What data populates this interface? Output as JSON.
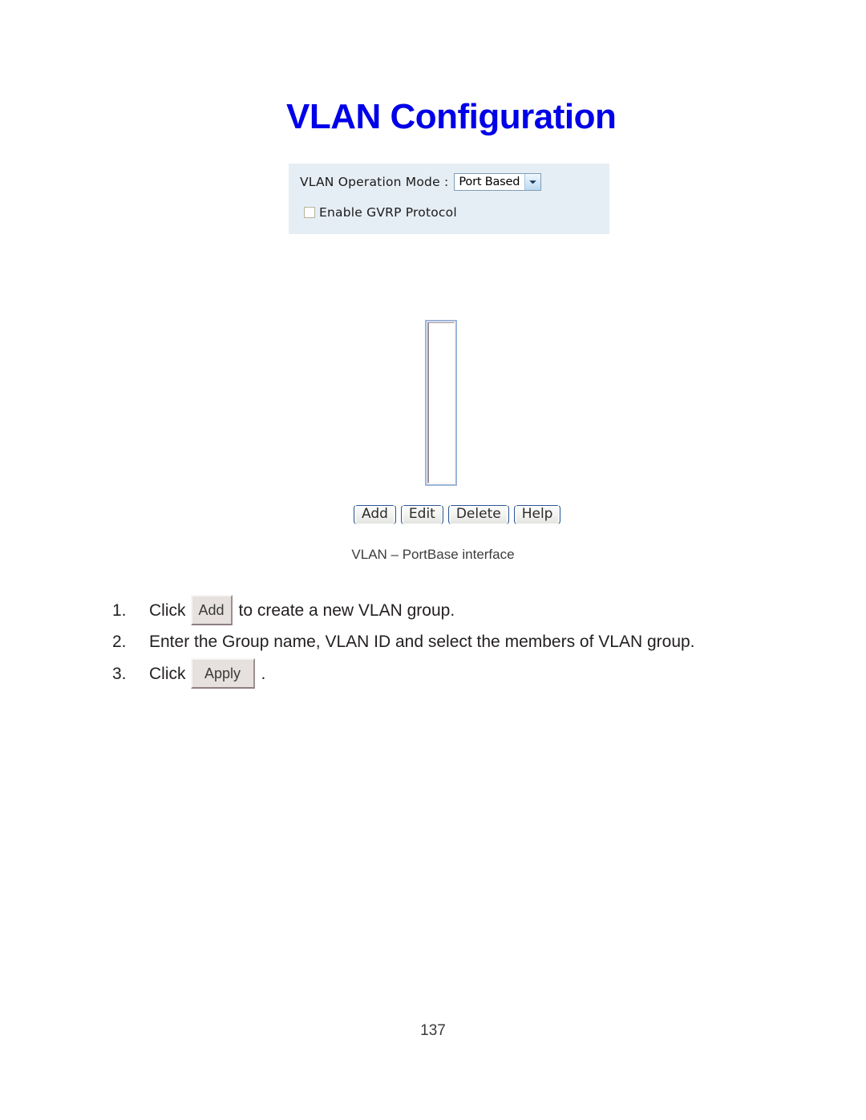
{
  "document": {
    "page_number": "137"
  },
  "page_title": "VLAN Configuration",
  "settings_panel": {
    "operation_mode": {
      "label": "VLAN Operation Mode :",
      "selected_value": "Port Based",
      "arrow_icon": "chevron-down-icon"
    },
    "gvrp": {
      "label": "Enable GVRP Protocol",
      "checked": false
    },
    "background_color": "#e6eef5"
  },
  "vlan_list": {
    "items": [],
    "empty": true
  },
  "buttons": [
    {
      "label": "Add"
    },
    {
      "label": "Edit"
    },
    {
      "label": "Delete"
    },
    {
      "label": "Help"
    }
  ],
  "figure_caption": "VLAN – PortBase interface",
  "steps": [
    {
      "number": "1.",
      "pre_text": "Click",
      "button_label": "Add",
      "post_text": "to create a new VLAN group."
    },
    {
      "number": "2.",
      "pre_text": "Enter the Group name, VLAN ID and select the members of VLAN group.",
      "button_label": "",
      "post_text": ""
    },
    {
      "number": "3.",
      "pre_text": "Click",
      "button_label": "Apply",
      "post_text": "."
    }
  ],
  "colors": {
    "title": "#0000e8",
    "panel_bg": "#e6eef5",
    "listbox_border": "#9cb4d8",
    "button_border": "#2b5797"
  }
}
